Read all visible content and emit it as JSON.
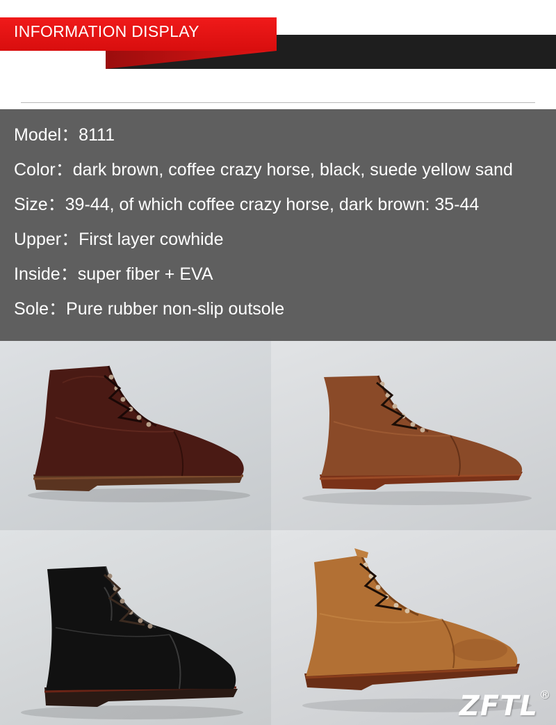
{
  "header": {
    "title": "INFORMATION DISPLAY"
  },
  "specs": [
    {
      "label": "Model：",
      "value": "8111"
    },
    {
      "label": "Color：",
      "value": "dark brown, coffee crazy horse, black, suede yellow sand"
    },
    {
      "label": "Size：",
      "value": "39-44, of which coffee crazy horse, dark brown: 35-44"
    },
    {
      "label": "Upper：",
      "value": "First layer cowhide"
    },
    {
      "label": "Inside：",
      "value": "super fiber + EVA"
    },
    {
      "label": "Sole：",
      "value": "Pure rubber non-slip outsole"
    }
  ],
  "photos": [
    {
      "variant": "dark brown",
      "leather": "#4a1a14"
    },
    {
      "variant": "coffee crazy horse",
      "leather": "#8a4a28"
    },
    {
      "variant": "black",
      "leather": "#111111"
    },
    {
      "variant": "suede yellow sand",
      "leather": "#b27034"
    }
  ],
  "brand": {
    "logo": "ZFTL",
    "mark": "®"
  },
  "colors": {
    "accent": "#e01414",
    "bar": "#1e1e1e",
    "panel": "#5f5f5f"
  }
}
